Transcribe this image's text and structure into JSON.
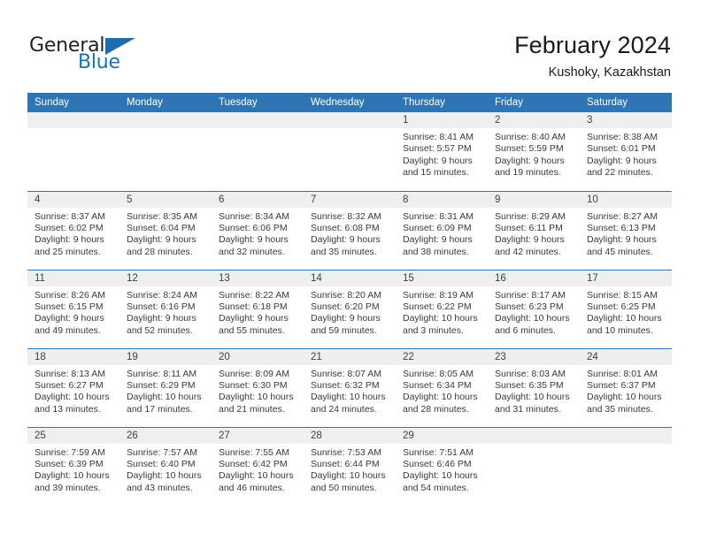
{
  "brand": {
    "name_part1": "General",
    "name_part2": "Blue"
  },
  "header": {
    "month_title": "February 2024",
    "location": "Kushoky, Kazakhstan"
  },
  "colors": {
    "header_blue": "#2e75b6",
    "brand_blue": "#1b72b8",
    "daynum_band": "#efefef"
  },
  "weekdays": [
    "Sunday",
    "Monday",
    "Tuesday",
    "Wednesday",
    "Thursday",
    "Friday",
    "Saturday"
  ],
  "calendar": {
    "weeks": [
      [
        {
          "day": "",
          "lines": []
        },
        {
          "day": "",
          "lines": []
        },
        {
          "day": "",
          "lines": []
        },
        {
          "day": "",
          "lines": []
        },
        {
          "day": "1",
          "lines": [
            "Sunrise: 8:41 AM",
            "Sunset: 5:57 PM",
            "Daylight: 9 hours",
            "and 15 minutes."
          ]
        },
        {
          "day": "2",
          "lines": [
            "Sunrise: 8:40 AM",
            "Sunset: 5:59 PM",
            "Daylight: 9 hours",
            "and 19 minutes."
          ]
        },
        {
          "day": "3",
          "lines": [
            "Sunrise: 8:38 AM",
            "Sunset: 6:01 PM",
            "Daylight: 9 hours",
            "and 22 minutes."
          ]
        }
      ],
      [
        {
          "day": "4",
          "lines": [
            "Sunrise: 8:37 AM",
            "Sunset: 6:02 PM",
            "Daylight: 9 hours",
            "and 25 minutes."
          ]
        },
        {
          "day": "5",
          "lines": [
            "Sunrise: 8:35 AM",
            "Sunset: 6:04 PM",
            "Daylight: 9 hours",
            "and 28 minutes."
          ]
        },
        {
          "day": "6",
          "lines": [
            "Sunrise: 8:34 AM",
            "Sunset: 6:06 PM",
            "Daylight: 9 hours",
            "and 32 minutes."
          ]
        },
        {
          "day": "7",
          "lines": [
            "Sunrise: 8:32 AM",
            "Sunset: 6:08 PM",
            "Daylight: 9 hours",
            "and 35 minutes."
          ]
        },
        {
          "day": "8",
          "lines": [
            "Sunrise: 8:31 AM",
            "Sunset: 6:09 PM",
            "Daylight: 9 hours",
            "and 38 minutes."
          ]
        },
        {
          "day": "9",
          "lines": [
            "Sunrise: 8:29 AM",
            "Sunset: 6:11 PM",
            "Daylight: 9 hours",
            "and 42 minutes."
          ]
        },
        {
          "day": "10",
          "lines": [
            "Sunrise: 8:27 AM",
            "Sunset: 6:13 PM",
            "Daylight: 9 hours",
            "and 45 minutes."
          ]
        }
      ],
      [
        {
          "day": "11",
          "lines": [
            "Sunrise: 8:26 AM",
            "Sunset: 6:15 PM",
            "Daylight: 9 hours",
            "and 49 minutes."
          ]
        },
        {
          "day": "12",
          "lines": [
            "Sunrise: 8:24 AM",
            "Sunset: 6:16 PM",
            "Daylight: 9 hours",
            "and 52 minutes."
          ]
        },
        {
          "day": "13",
          "lines": [
            "Sunrise: 8:22 AM",
            "Sunset: 6:18 PM",
            "Daylight: 9 hours",
            "and 55 minutes."
          ]
        },
        {
          "day": "14",
          "lines": [
            "Sunrise: 8:20 AM",
            "Sunset: 6:20 PM",
            "Daylight: 9 hours",
            "and 59 minutes."
          ]
        },
        {
          "day": "15",
          "lines": [
            "Sunrise: 8:19 AM",
            "Sunset: 6:22 PM",
            "Daylight: 10 hours",
            "and 3 minutes."
          ]
        },
        {
          "day": "16",
          "lines": [
            "Sunrise: 8:17 AM",
            "Sunset: 6:23 PM",
            "Daylight: 10 hours",
            "and 6 minutes."
          ]
        },
        {
          "day": "17",
          "lines": [
            "Sunrise: 8:15 AM",
            "Sunset: 6:25 PM",
            "Daylight: 10 hours",
            "and 10 minutes."
          ]
        }
      ],
      [
        {
          "day": "18",
          "lines": [
            "Sunrise: 8:13 AM",
            "Sunset: 6:27 PM",
            "Daylight: 10 hours",
            "and 13 minutes."
          ]
        },
        {
          "day": "19",
          "lines": [
            "Sunrise: 8:11 AM",
            "Sunset: 6:29 PM",
            "Daylight: 10 hours",
            "and 17 minutes."
          ]
        },
        {
          "day": "20",
          "lines": [
            "Sunrise: 8:09 AM",
            "Sunset: 6:30 PM",
            "Daylight: 10 hours",
            "and 21 minutes."
          ]
        },
        {
          "day": "21",
          "lines": [
            "Sunrise: 8:07 AM",
            "Sunset: 6:32 PM",
            "Daylight: 10 hours",
            "and 24 minutes."
          ]
        },
        {
          "day": "22",
          "lines": [
            "Sunrise: 8:05 AM",
            "Sunset: 6:34 PM",
            "Daylight: 10 hours",
            "and 28 minutes."
          ]
        },
        {
          "day": "23",
          "lines": [
            "Sunrise: 8:03 AM",
            "Sunset: 6:35 PM",
            "Daylight: 10 hours",
            "and 31 minutes."
          ]
        },
        {
          "day": "24",
          "lines": [
            "Sunrise: 8:01 AM",
            "Sunset: 6:37 PM",
            "Daylight: 10 hours",
            "and 35 minutes."
          ]
        }
      ],
      [
        {
          "day": "25",
          "lines": [
            "Sunrise: 7:59 AM",
            "Sunset: 6:39 PM",
            "Daylight: 10 hours",
            "and 39 minutes."
          ]
        },
        {
          "day": "26",
          "lines": [
            "Sunrise: 7:57 AM",
            "Sunset: 6:40 PM",
            "Daylight: 10 hours",
            "and 43 minutes."
          ]
        },
        {
          "day": "27",
          "lines": [
            "Sunrise: 7:55 AM",
            "Sunset: 6:42 PM",
            "Daylight: 10 hours",
            "and 46 minutes."
          ]
        },
        {
          "day": "28",
          "lines": [
            "Sunrise: 7:53 AM",
            "Sunset: 6:44 PM",
            "Daylight: 10 hours",
            "and 50 minutes."
          ]
        },
        {
          "day": "29",
          "lines": [
            "Sunrise: 7:51 AM",
            "Sunset: 6:46 PM",
            "Daylight: 10 hours",
            "and 54 minutes."
          ]
        },
        {
          "day": "",
          "lines": []
        },
        {
          "day": "",
          "lines": []
        }
      ]
    ]
  }
}
